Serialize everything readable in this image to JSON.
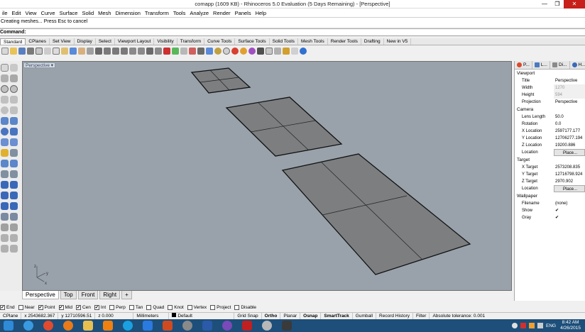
{
  "title": "comapp (1609 KB) - Rhinoceros 5.0 Evaluation (5 Days Remaining) - [Perspective]",
  "window_controls": {
    "minimize": "—",
    "maximize": "❐",
    "close": "✕"
  },
  "menu": [
    "ile",
    "Edit",
    "View",
    "Curve",
    "Surface",
    "Solid",
    "Mesh",
    "Dimension",
    "Transform",
    "Tools",
    "Analyze",
    "Render",
    "Panels",
    "Help"
  ],
  "command_history": "Creating meshes... Press Esc to cancel",
  "command_prompt": "Command:",
  "toolbar_tabs": [
    "Standard",
    "CPlanes",
    "Set View",
    "Display",
    "Select",
    "Viewport Layout",
    "Visibility",
    "Transform",
    "Curve Tools",
    "Surface Tools",
    "Solid Tools",
    "Mesh Tools",
    "Render Tools",
    "Drafting",
    "New in V5"
  ],
  "viewport": {
    "label": "Perspective",
    "axis_labels": [
      "z",
      "y",
      "x"
    ]
  },
  "view_tabs": [
    "Perspective",
    "Top",
    "Front",
    "Right",
    "+"
  ],
  "osnaps": [
    {
      "label": "End",
      "checked": true
    },
    {
      "label": "Near",
      "checked": false
    },
    {
      "label": "Point",
      "checked": true
    },
    {
      "label": "Mid",
      "checked": true
    },
    {
      "label": "Cen",
      "checked": true
    },
    {
      "label": "Int",
      "checked": true
    },
    {
      "label": "Perp",
      "checked": false
    },
    {
      "label": "Tan",
      "checked": false
    },
    {
      "label": "Quad",
      "checked": false
    },
    {
      "label": "Knot",
      "checked": false
    },
    {
      "label": "Vertex",
      "checked": false
    },
    {
      "label": "Project",
      "checked": false
    },
    {
      "label": "Disable",
      "checked": false
    }
  ],
  "status": {
    "cplane": "CPlane",
    "x": "x 2543682.367",
    "y": "y 12710596.51",
    "z": "z 0.000",
    "units": "Millimeters",
    "layer": "Default",
    "grid_snap": "Grid Snap",
    "ortho": "Ortho",
    "planar": "Planar",
    "osnap": "Osnap",
    "smarttrack": "SmartTrack",
    "gumball": "Gumball",
    "record_history": "Record History",
    "filter": "Filter",
    "tolerance": "Absolute tolerance: 0.001"
  },
  "panel": {
    "tabs": [
      "P...",
      "L...",
      "Di...",
      "H..."
    ],
    "viewport_section": "Viewport",
    "viewport_rows": [
      {
        "label": "Title",
        "value": "Perspective",
        "disabled": false
      },
      {
        "label": "Width",
        "value": "1270",
        "disabled": true
      },
      {
        "label": "Height",
        "value": "594",
        "disabled": true
      },
      {
        "label": "Projection",
        "value": "Perspective",
        "disabled": false
      }
    ],
    "camera_section": "Camera",
    "camera_rows": [
      {
        "label": "Lens Length",
        "value": "50.0"
      },
      {
        "label": "Rotation",
        "value": "0.0"
      },
      {
        "label": "X Location",
        "value": "2597177.177"
      },
      {
        "label": "Y Location",
        "value": "12706277.194"
      },
      {
        "label": "Z Location",
        "value": "19200.886"
      },
      {
        "label": "Location",
        "value": "Place..."
      }
    ],
    "target_section": "Target",
    "target_rows": [
      {
        "label": "X Target",
        "value": "2573208.835"
      },
      {
        "label": "Y Target",
        "value": "12716798.924"
      },
      {
        "label": "Z Target",
        "value": "2970.902"
      },
      {
        "label": "Location",
        "value": "Place..."
      }
    ],
    "wallpaper_section": "Wallpaper",
    "wallpaper_rows": [
      {
        "label": "Filename",
        "value": "(none)"
      },
      {
        "label": "Show",
        "value": "✔"
      },
      {
        "label": "Gray",
        "value": "✔"
      }
    ]
  },
  "clock": {
    "time": "8:42 AM",
    "date": "4/26/2015"
  },
  "tray_lang": "ENG"
}
